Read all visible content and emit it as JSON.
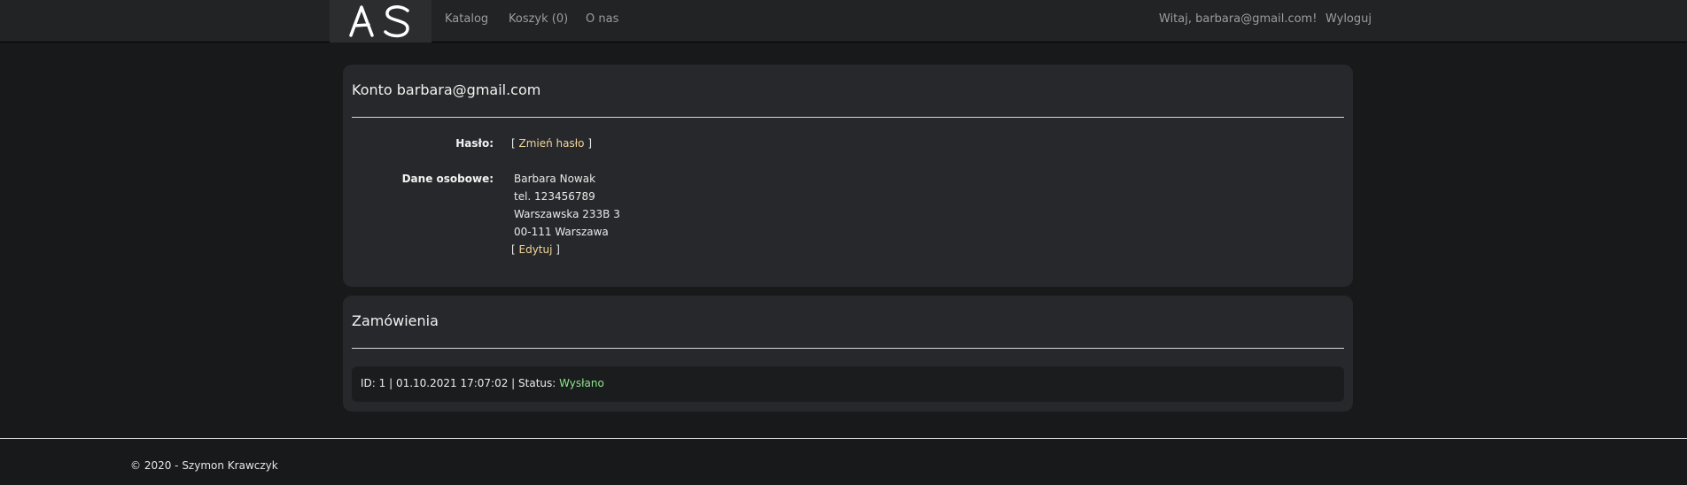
{
  "nav": {
    "logo_text": "AS",
    "links": [
      "Katalog",
      "Koszyk (0)",
      "O nas"
    ],
    "greeting": "Witaj, barbara@gmail.com!",
    "logout": "Wyloguj"
  },
  "account": {
    "title": "Konto barbara@gmail.com",
    "password_label": "Hasło:",
    "password_link": "Zmień hasło",
    "personal_label": "Dane osobowe:",
    "personal_lines": [
      "Barbara Nowak",
      "tel. 123456789",
      "Warszawska 233B 3",
      "00-111 Warszawa"
    ],
    "edit_link": "Edytuj",
    "bracket_open": "[ ",
    "bracket_close": " ]"
  },
  "orders": {
    "title": "Zamówienia",
    "items": [
      {
        "summary": "ID: 1 | 01.10.2021 17:07:02 | Status: ",
        "status": "Wysłano"
      }
    ]
  },
  "footer": {
    "text": "© 2020 - Szymon Krawczyk"
  },
  "colors": {
    "link": "#f2d69a",
    "status_ok": "#8fe58a",
    "background": "#18191b",
    "card": "#27282b"
  }
}
